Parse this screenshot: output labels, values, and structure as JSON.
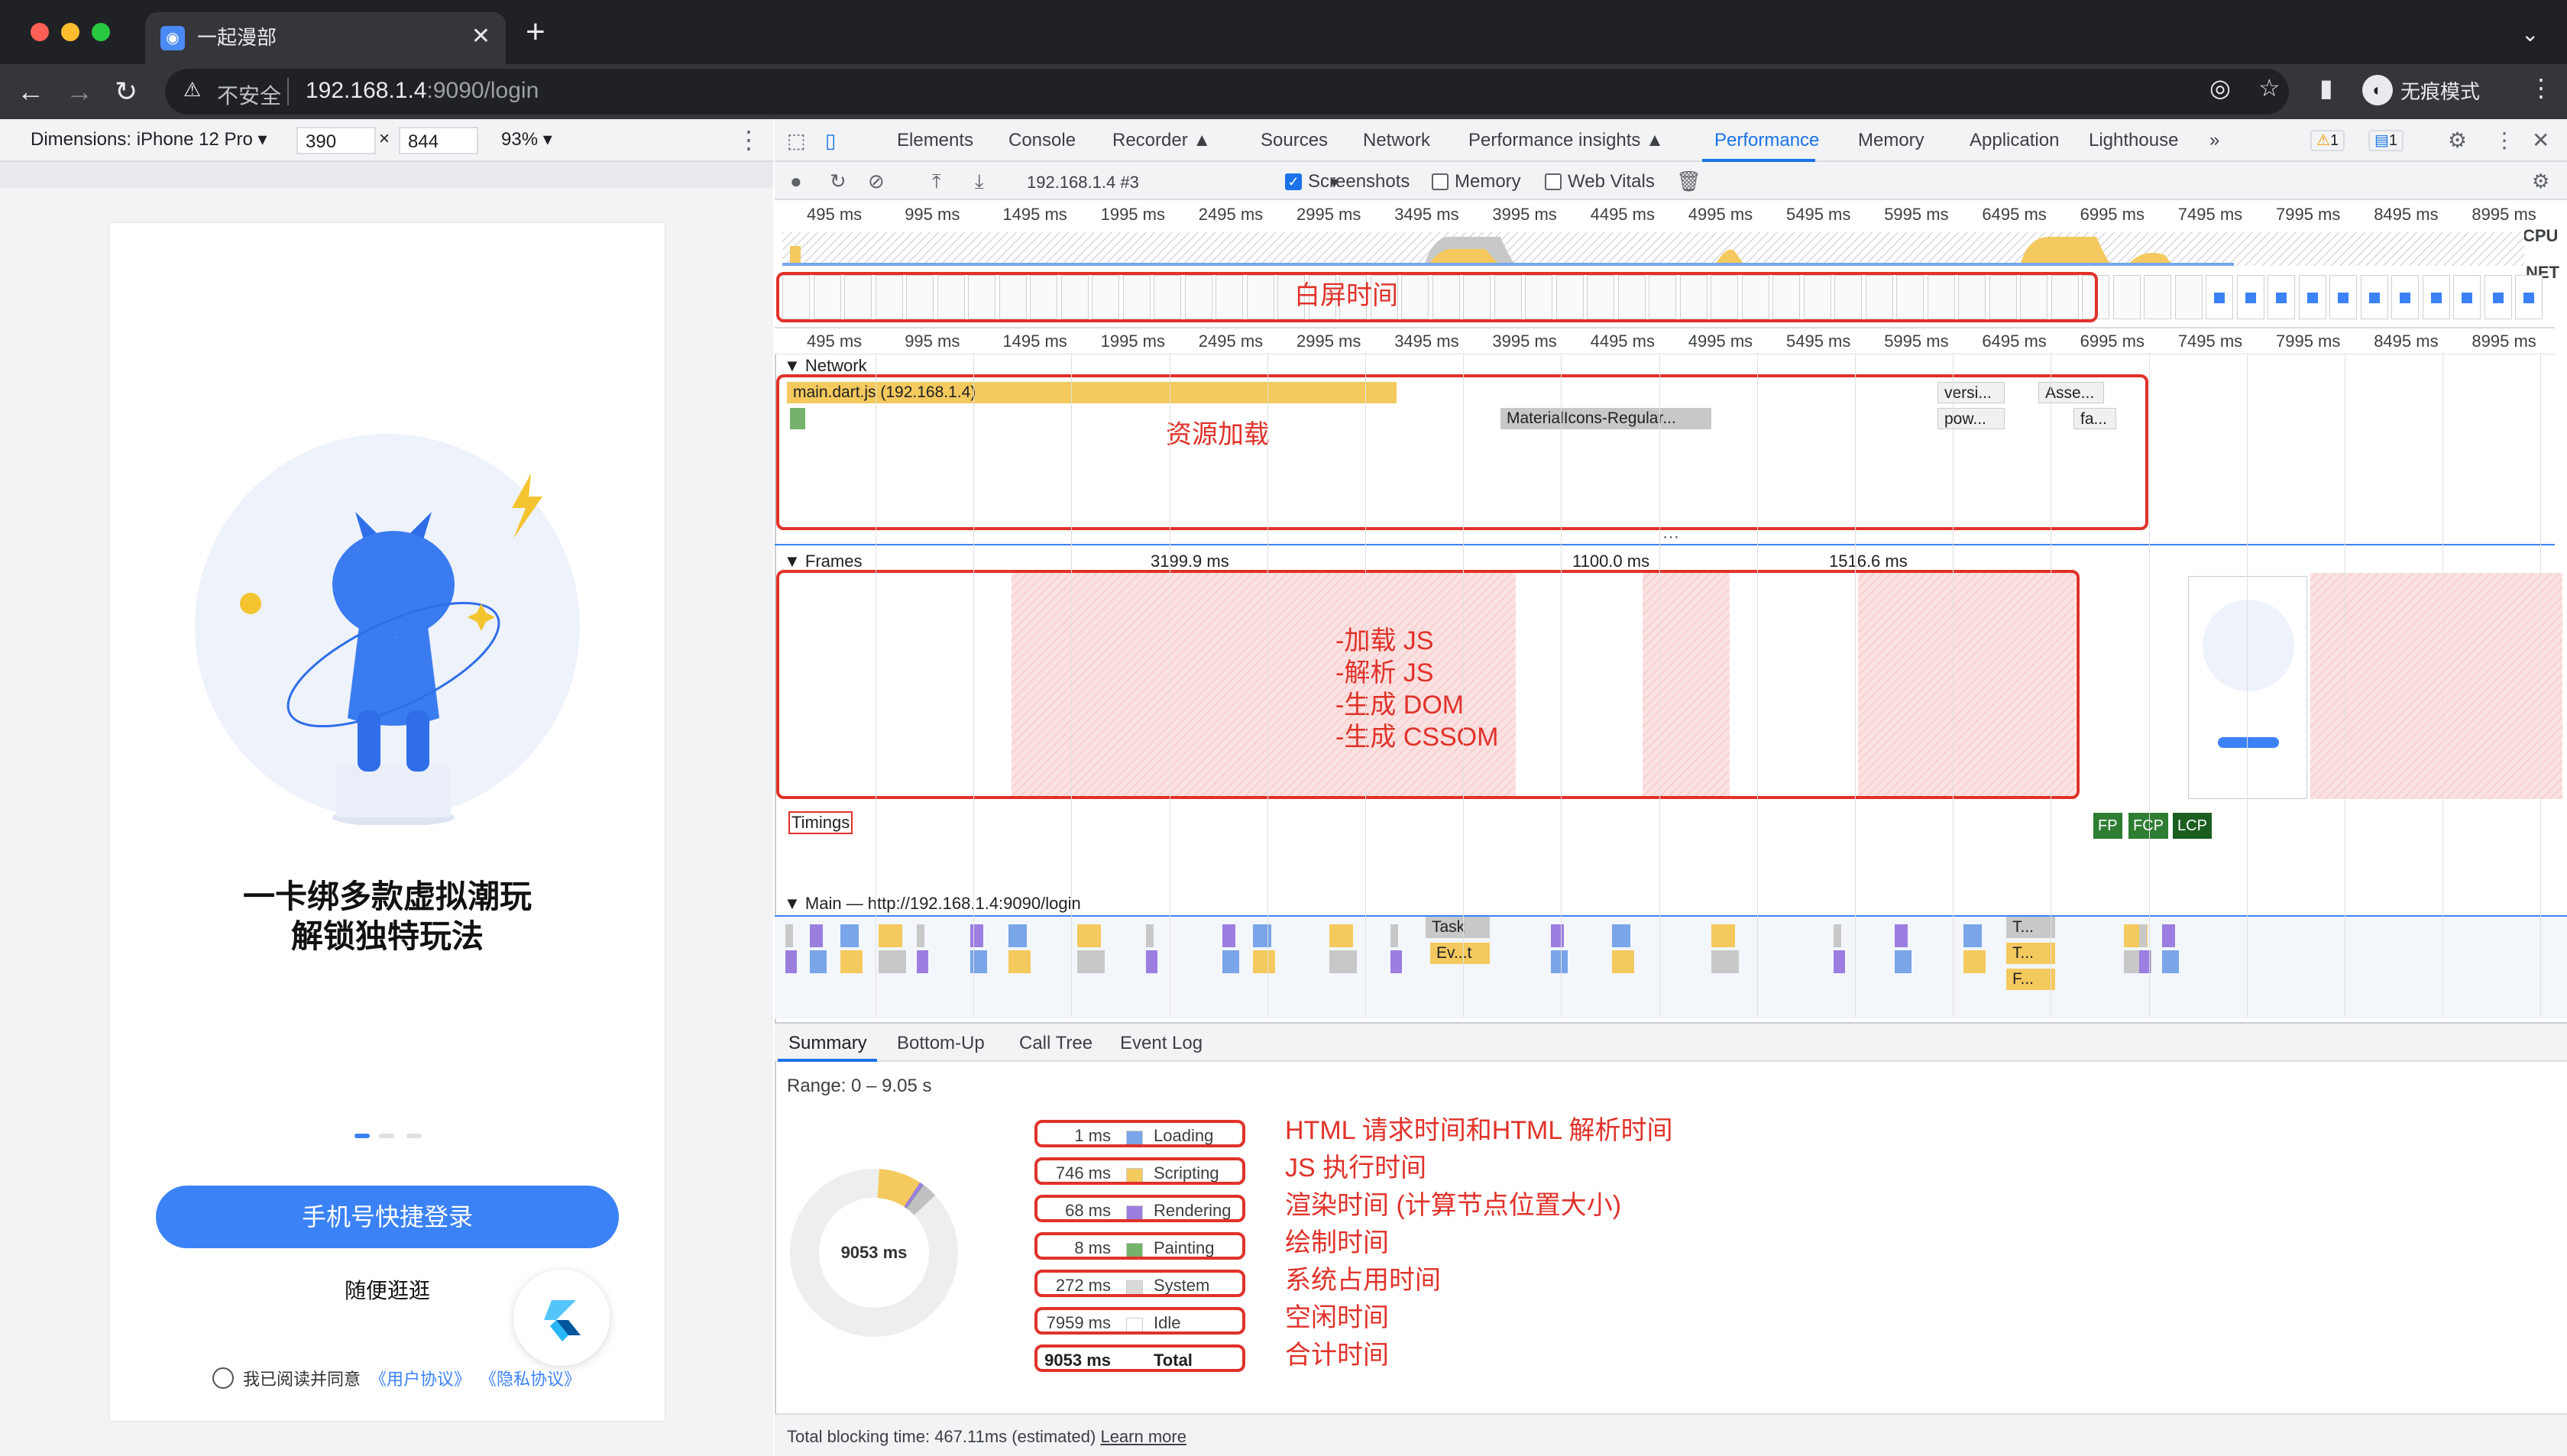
{
  "browser": {
    "tab_title": "一起漫部",
    "new_tab": "+",
    "insecure_label": "不安全",
    "url_host": "192.168.1.4",
    "url_rest": ":9090/login",
    "incognito_label": "无痕模式"
  },
  "device_toolbar": {
    "dimensions": "Dimensions: iPhone 12 Pro ▾",
    "width": "390",
    "height": "844",
    "times": "×",
    "zoom": "93% ▾"
  },
  "app": {
    "headline_1": "一卡绑多款虚拟潮玩",
    "headline_2": "解锁独特玩法",
    "login_button": "手机号快捷登录",
    "browse_link": "随便逛逛",
    "agree_prefix": "我已阅读并同意",
    "user_agreement": "《用户协议》",
    "privacy_policy": "《隐私协议》"
  },
  "devtools": {
    "tabs": [
      "Elements",
      "Console",
      "Recorder ▲",
      "Sources",
      "Network",
      "Performance insights ▲",
      "Performance",
      "Memory",
      "Application",
      "Lighthouse",
      "»"
    ],
    "active_tab": "Performance",
    "warn_count": "1",
    "msg_count": "1",
    "profile_select": "192.168.1.4 #3",
    "screenshots_label": "Screenshots",
    "memory_label": "Memory",
    "webvitals_label": "Web Vitals",
    "cpu_label": "CPU",
    "net_label": "NET",
    "ticks": [
      "495 ms",
      "995 ms",
      "1495 ms",
      "1995 ms",
      "2495 ms",
      "2995 ms",
      "3495 ms",
      "3995 ms",
      "4495 ms",
      "4995 ms",
      "5495 ms",
      "5995 ms",
      "6495 ms",
      "6995 ms",
      "7495 ms",
      "7995 ms",
      "8495 ms",
      "8995 ms"
    ],
    "network_label": "Network",
    "network_main": "main.dart.js (192.168.1.4)",
    "network_font": "MaterialIcons-Regular...",
    "network_small": [
      "versi...",
      "pow...",
      "Asse...",
      "fa..."
    ],
    "frames_label": "Frames",
    "frame_times": [
      "3199.9 ms",
      "1100.0 ms",
      "1516.6 ms"
    ],
    "timings_label": "Timings",
    "markers": [
      "FP",
      "FCP",
      "LCP"
    ],
    "main_label": "Main — http://192.168.1.4:9090/login",
    "task_labels": [
      "Task",
      "Ev...t",
      "T...",
      "T...",
      "F..."
    ],
    "bottom_tabs": [
      "Summary",
      "Bottom-Up",
      "Call Tree",
      "Event Log"
    ],
    "range": "Range: 0 – 9.05 s",
    "donut_total": "9053 ms",
    "summary": [
      {
        "value": "1 ms",
        "label": "Loading",
        "color": "#7aa5e8"
      },
      {
        "value": "746 ms",
        "label": "Scripting",
        "color": "#f4c95d"
      },
      {
        "value": "68 ms",
        "label": "Rendering",
        "color": "#9b7ee0"
      },
      {
        "value": "8 ms",
        "label": "Painting",
        "color": "#75b26b"
      },
      {
        "value": "272 ms",
        "label": "System",
        "color": "#d9d9d9"
      },
      {
        "value": "7959 ms",
        "label": "Idle",
        "color": "#ffffff"
      },
      {
        "value": "9053 ms",
        "label": "Total",
        "color": ""
      }
    ],
    "footer_text": "Total blocking time: 467.11ms (estimated)",
    "footer_link": "Learn more"
  },
  "annotations": {
    "white_screen": "白屏时间",
    "resource_loading": "资源加载",
    "js_steps": [
      "-加载 JS",
      "-解析 JS",
      "-生成 DOM",
      "-生成 CSSOM"
    ],
    "legend_notes": [
      "HTML 请求时间和HTML 解析时间",
      "JS 执行时间",
      "渲染时间 (计算节点位置大小)",
      "绘制时间",
      "系统占用时间",
      "空闲时间",
      "合计时间"
    ]
  }
}
